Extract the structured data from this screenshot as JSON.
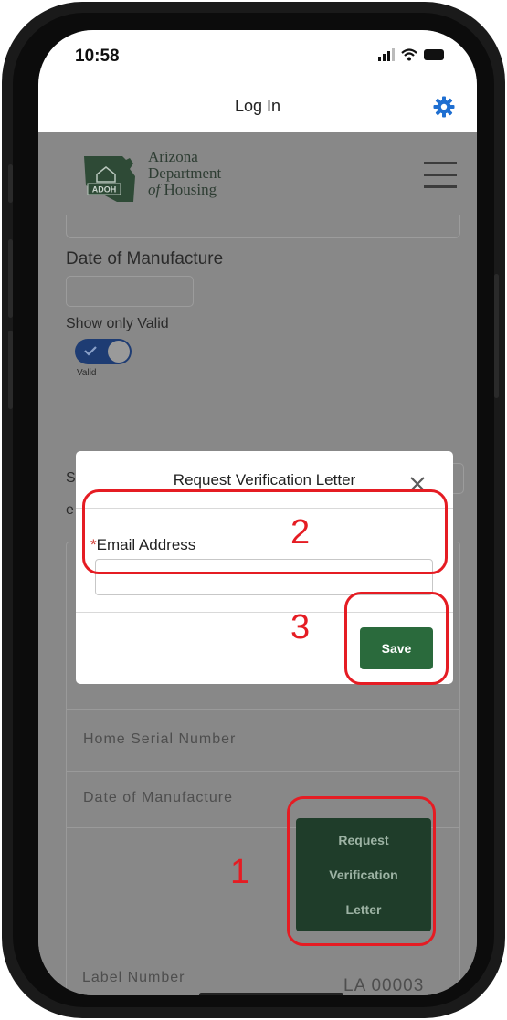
{
  "status_bar": {
    "time": "10:58"
  },
  "nav": {
    "title": "Log In",
    "settings_icon": "gear-icon"
  },
  "logo": {
    "badge_text": "ADOH",
    "line1": "Arizona",
    "line2": "Department",
    "line3_italic": "of",
    "line3_rest": " Housing"
  },
  "filters": {
    "date_of_manufacture_label": "Date of Manufacture",
    "show_only_valid_label": "Show only Valid",
    "toggle_caption": "Valid",
    "sort_label_partial": "S",
    "sort_label_partial2": "e"
  },
  "results": {
    "home_serial_number_label": "Home Serial Number",
    "date_of_manufacture_label": "Date of Manufacture",
    "request_button": {
      "line1": "Request",
      "line2": "Verification",
      "line3": "Letter"
    },
    "label_number_label": "Label Number",
    "label_number_value": "LA 00003"
  },
  "modal": {
    "title": "Request Verification Letter",
    "email_label": "Email Address",
    "required_marker": "*",
    "email_value": "",
    "save_label": "Save"
  },
  "callouts": {
    "one": "1",
    "two": "2",
    "three": "3"
  },
  "colors": {
    "accent_green": "#2a6a3c",
    "dark_green": "#1f3d2a",
    "callout_red": "#e51c23",
    "gear_blue": "#1f6fd1",
    "toggle_blue": "#1e3c73"
  }
}
